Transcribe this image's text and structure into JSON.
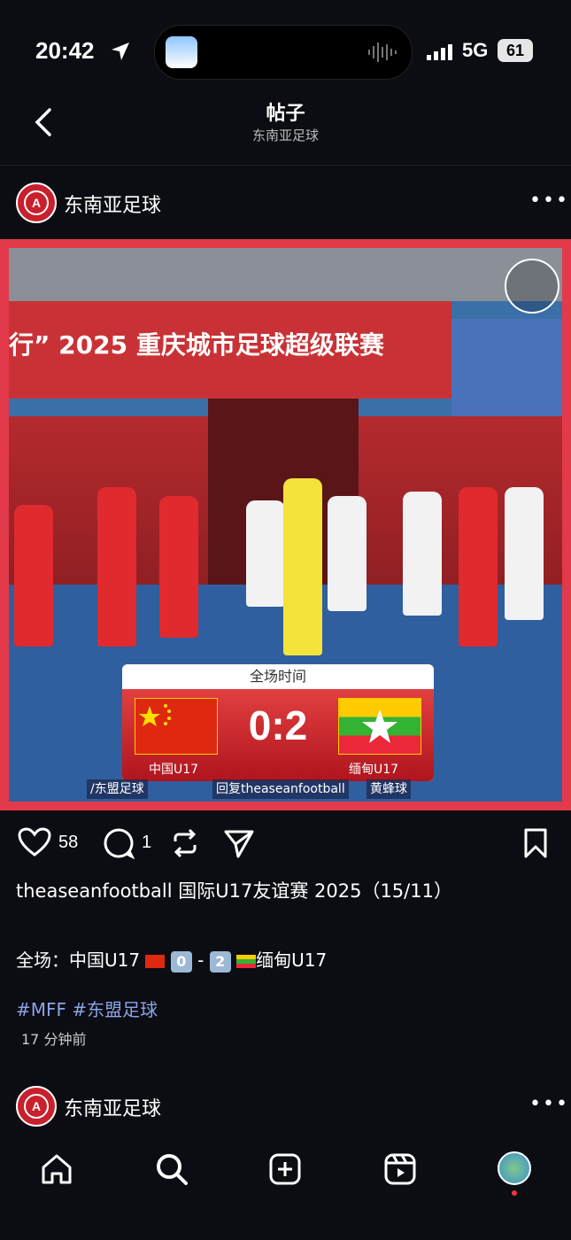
{
  "status_bar": {
    "time": "20:42",
    "network": "5G",
    "battery": "61"
  },
  "header": {
    "title": "帖子",
    "subtitle": "东南亚足球"
  },
  "post": {
    "account_name": "东南亚足球",
    "avatar_letter": "A",
    "image": {
      "banner_text": "行” 2025 重庆城市足球超级联赛",
      "scoreboard": {
        "header": "全场时间",
        "score": "0:2",
        "home_team": "中国U17",
        "away_team": "缅甸U17"
      },
      "credits": [
        "/东盟足球",
        "回复theaseanfootball",
        "黄蜂球"
      ]
    },
    "likes": "58",
    "comments": "1",
    "caption": "theaseanfootball  国际U17友谊赛 2025（15/11）",
    "result_prefix": "全场：中国U17",
    "home_score": "0",
    "away_score": "2",
    "result_suffix": "缅甸U17",
    "hashtags": "#MFF #东盟足球",
    "time_ago": "17 分钟前"
  },
  "next_post": {
    "account_name": "东南亚足球"
  },
  "tabbar": [
    "home-icon",
    "search-icon",
    "create-icon",
    "reels-icon",
    "profile-avatar"
  ]
}
